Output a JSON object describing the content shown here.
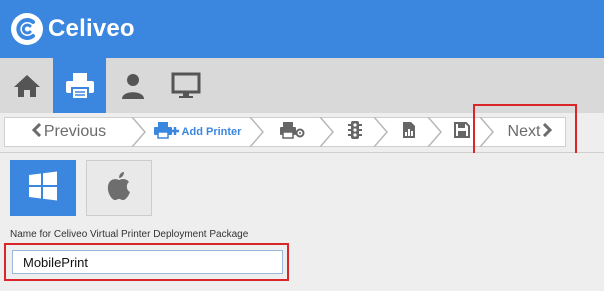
{
  "header": {
    "brand": "Celiveo",
    "logo_icon": "celiveo-logo-icon",
    "bg_color": "#3b86df"
  },
  "nav": {
    "tabs": [
      {
        "id": "home",
        "icon": "home-icon",
        "active": false
      },
      {
        "id": "printer",
        "icon": "printer-icon",
        "active": true
      },
      {
        "id": "user",
        "icon": "user-icon",
        "active": false
      },
      {
        "id": "monitor",
        "icon": "monitor-icon",
        "active": false
      }
    ]
  },
  "wizard": {
    "previous_label": "Previous",
    "add_printer_label": "Add Printer",
    "next_label": "Next",
    "steps": [
      {
        "icon": "printer-settings-icon"
      },
      {
        "icon": "traffic-light-icon"
      },
      {
        "icon": "report-icon"
      },
      {
        "icon": "save-icon"
      }
    ]
  },
  "content": {
    "os_options": [
      {
        "name": "Windows",
        "icon": "windows-icon",
        "selected": true
      },
      {
        "name": "Apple",
        "icon": "apple-icon",
        "selected": false
      }
    ],
    "package_name_label": "Name for Celiveo Virtual Printer Deployment Package",
    "package_name_value": "MobilePrint"
  },
  "colors": {
    "accent": "#3b86df",
    "highlight": "#d9262a",
    "nav_bg": "#d9d9d9"
  }
}
